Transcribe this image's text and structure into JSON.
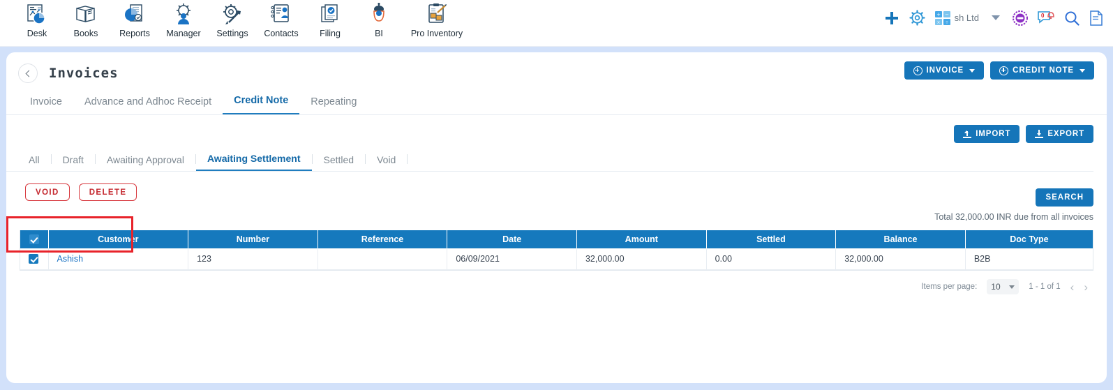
{
  "appbar": {
    "modules": [
      {
        "label": "Desk",
        "icon": "desk-chart-icon"
      },
      {
        "label": "Books",
        "icon": "books-open-book-icon"
      },
      {
        "label": "Reports",
        "icon": "reports-piechart-icon"
      },
      {
        "label": "Manager",
        "icon": "manager-gear-person-icon"
      },
      {
        "label": "Settings",
        "icon": "settings-wrench-gear-icon"
      },
      {
        "label": "Contacts",
        "icon": "contacts-person-card-icon"
      },
      {
        "label": "Filing",
        "icon": "filing-documents-icon"
      },
      {
        "label": "BI",
        "icon": "bi-robot-icon"
      },
      {
        "label": "Pro Inventory",
        "icon": "pro-inventory-clipboard-box-icon"
      }
    ],
    "right": {
      "add_icon": "plus-icon",
      "settings_icon": "gear-icon",
      "calculator_icon": "calculator-icon",
      "company": "sh Ltd",
      "chevron_icon": "chevron-down-icon",
      "rewards_icon": "badge-icon",
      "chat_icon": "chat-notification-icon",
      "chat_badge": "0",
      "search_icon": "search-icon",
      "doc_icon": "document-icon"
    }
  },
  "header": {
    "back_icon": "back-chevron-icon",
    "title": "Invoices",
    "invoice_button": "INVOICE",
    "credit_note_button": "CREDIT NOTE"
  },
  "doc_tabs": [
    {
      "label": "Invoice",
      "active": false
    },
    {
      "label": "Advance and Adhoc Receipt",
      "active": false
    },
    {
      "label": "Credit Note",
      "active": true
    },
    {
      "label": "Repeating",
      "active": false
    }
  ],
  "toolbar": {
    "import_label": "IMPORT",
    "export_label": "EXPORT"
  },
  "status_tabs": [
    {
      "label": "All",
      "active": false
    },
    {
      "label": "Draft",
      "active": false
    },
    {
      "label": "Awaiting Approval",
      "active": false
    },
    {
      "label": "Awaiting Settlement",
      "active": true
    },
    {
      "label": "Settled",
      "active": false
    },
    {
      "label": "Void",
      "active": false
    }
  ],
  "actions": {
    "void_label": "VOID",
    "delete_label": "DELETE",
    "highlight_color": "#e8232a"
  },
  "search": {
    "button_label": "SEARCH",
    "total_text": "Total 32,000.00 INR due from all invoices"
  },
  "table": {
    "columns": [
      "Customer",
      "Number",
      "Reference",
      "Date",
      "Amount",
      "Settled",
      "Balance",
      "Doc Type"
    ],
    "header_checkbox_checked": true,
    "rows": [
      {
        "checked": true,
        "customer": "Ashish",
        "number": "123",
        "reference": "",
        "date": "06/09/2021",
        "amount": "32,000.00",
        "settled": "0.00",
        "balance": "32,000.00",
        "doc_type": "B2B"
      }
    ]
  },
  "pagination": {
    "items_per_page_label": "Items per page:",
    "items_per_page_value": "10",
    "range": "1 - 1 of 1",
    "prev_icon": "chevron-left-icon",
    "next_icon": "chevron-right-icon"
  },
  "colors": {
    "primary_blue": "#1575b9",
    "table_header_blue": "#1579bd",
    "page_background": "#d2e1fa",
    "danger_red": "#d7373d",
    "link_blue": "#1a73c4"
  }
}
